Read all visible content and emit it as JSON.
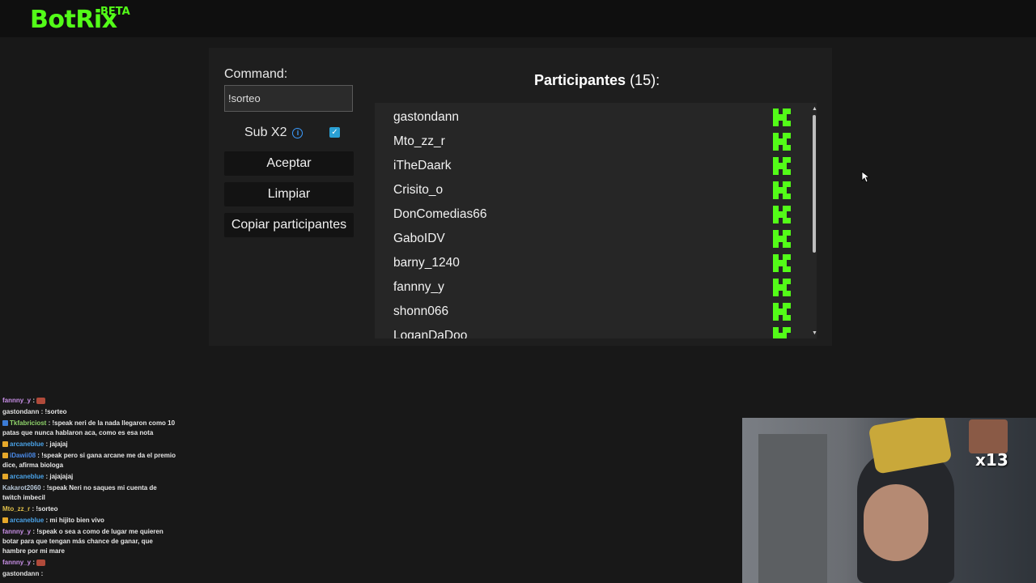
{
  "header": {
    "logo": "BotRix",
    "logo_badge": "BETA"
  },
  "form": {
    "command_label": "Command:",
    "command_value": "!sorteo",
    "sub_label": "Sub X2",
    "sub_checked": true,
    "accept_label": "Aceptar",
    "clear_label": "Limpiar",
    "copy_label": "Copiar participantes"
  },
  "participants": {
    "title": "Participantes",
    "count": "(15):",
    "items": [
      "gastondann",
      "Mto_zz_r",
      "iTheDaark",
      "Crisito_o",
      "DonComedias66",
      "GaboIDV",
      "barny_1240",
      "fannny_y",
      "shonn066",
      "LoganDaDoo"
    ],
    "platform_icon": "kick-icon"
  },
  "chat": [
    {
      "user": "fannny_y",
      "text": " : ",
      "user_color": "#c88fe6",
      "badge": "",
      "emote": true
    },
    {
      "user": "gastondann",
      "text": " : !sorteo",
      "user_color": "#e0e0e0",
      "badge": "",
      "emote": false
    },
    {
      "user": "Tkfabriciost",
      "text": " : !speak neri de la nada llegaron como 10 patas que nunca hablaron aca, como es esa nota",
      "user_color": "#8fd46a",
      "badge": "#3b7bd6",
      "emote": false
    },
    {
      "user": "arcaneblue",
      "text": " : jajajaj",
      "user_color": "#4aa3e8",
      "badge": "#e6a82a",
      "emote": false
    },
    {
      "user": "iDawii08",
      "text": " : !speak pero si gana arcane me da el premio dice, afirma biologa",
      "user_color": "#4a8ae8",
      "badge": "#e6a82a",
      "emote": false
    },
    {
      "user": "arcaneblue",
      "text": " : jajajajaj",
      "user_color": "#4aa3e8",
      "badge": "#e6a82a",
      "emote": false
    },
    {
      "user": "Kakarot2060",
      "text": " : !speak Neri no saques mi cuenta de twitch imbecil",
      "user_color": "#b8c8d8",
      "badge": "",
      "emote": false
    },
    {
      "user": "Mto_zz_r",
      "text": " : !sorteo",
      "user_color": "#e0c04a",
      "badge": "",
      "emote": false
    },
    {
      "user": "arcaneblue",
      "text": " : mi hijito bien vivo",
      "user_color": "#4aa3e8",
      "badge": "#e6a82a",
      "emote": false
    },
    {
      "user": "fannny_y",
      "text": " : !speak o sea a como de lugar me quieren botar para que tengan más chance de ganar, que hambre por mi mare",
      "user_color": "#c88fe6",
      "badge": "",
      "emote": false
    },
    {
      "user": "fannny_y",
      "text": " : ",
      "user_color": "#c88fe6",
      "badge": "",
      "emote": true
    },
    {
      "user": "gastondann",
      "text": " : ",
      "user_color": "#e0e0e0",
      "badge": "",
      "emote": false
    }
  ],
  "webcam": {
    "multiplier": "x13"
  },
  "colors": {
    "accent": "#53fc18",
    "panel": "#1e1e1e",
    "list_bg": "#262626"
  }
}
